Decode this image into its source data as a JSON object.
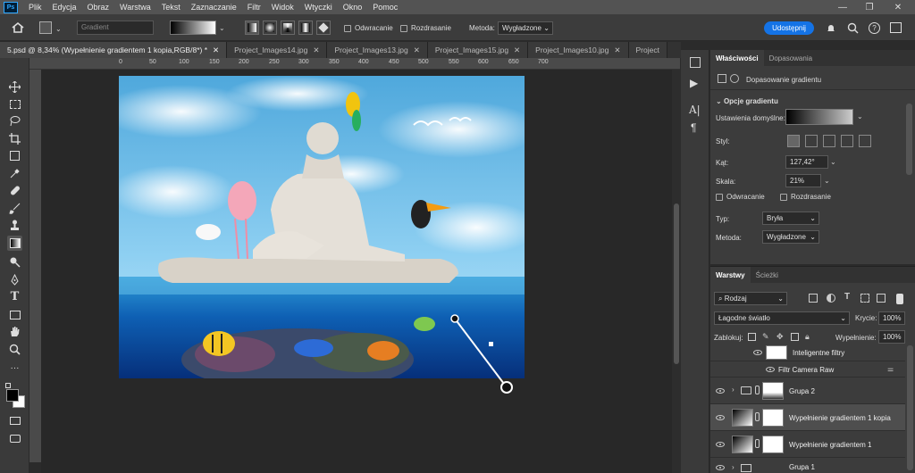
{
  "menubar": {
    "logo": "Ps",
    "items": [
      "Plik",
      "Edycja",
      "Obraz",
      "Warstwa",
      "Tekst",
      "Zaznaczanie",
      "Filtr",
      "Widok",
      "Wtyczki",
      "Okno",
      "Pomoc"
    ]
  },
  "options": {
    "preset_placeholder": "Gradient",
    "reverse_label": "Odwracanie",
    "dither_label": "Rozdrasanie",
    "method_label": "Metoda:",
    "method_value": "Wygładzone",
    "share_label": "Udostępnij"
  },
  "tabs": [
    {
      "label": "5.psd @ 8,34% (Wypełnienie gradientem 1 kopia,RGB/8*) *",
      "active": true
    },
    {
      "label": "Project_Images14.jpg",
      "active": false
    },
    {
      "label": "Project_Images13.jpg",
      "active": false
    },
    {
      "label": "Project_Images15.jpg",
      "active": false
    },
    {
      "label": "Project_Images10.jpg",
      "active": false
    },
    {
      "label": "Project",
      "active": false
    }
  ],
  "ruler": {
    "ticks": [
      "0",
      "50",
      "100",
      "150",
      "200",
      "250",
      "300",
      "350",
      "400",
      "450",
      "500",
      "550",
      "600",
      "650",
      "700"
    ]
  },
  "properties": {
    "tab_active": "Właściwości",
    "tab_other": "Dopasowania",
    "header": "Dopasowanie gradientu",
    "section": "Opcje gradientu",
    "preset_label": "Ustawienia domyślne:",
    "style_label": "Styl:",
    "angle_label": "Kąt:",
    "angle_value": "127,42°",
    "scale_label": "Skala:",
    "scale_value": "21%",
    "reverse_label": "Odwracanie",
    "dither_label": "Rozdrasanie",
    "type_label": "Typ:",
    "type_value": "Bryła",
    "method_label": "Metoda:",
    "method_value": "Wygładzone"
  },
  "layers": {
    "tab_active": "Warstwy",
    "tab_other": "Ścieżki",
    "filter_value": "Rodzaj",
    "blend_mode": "Łagodne światło",
    "opacity_label": "Krycie:",
    "opacity_value": "100%",
    "lock_label": "Zablokuj:",
    "fill_label": "Wypełnienie:",
    "fill_value": "100%",
    "rows": [
      {
        "name": "Inteligentne filtry"
      },
      {
        "name": "Filtr Camera Raw"
      },
      {
        "name": "Grupa 2"
      },
      {
        "name": "Wypełnienie gradientem 1 kopia"
      },
      {
        "name": "Wypełnienie gradientem 1"
      },
      {
        "name": "Grupa 1"
      }
    ]
  },
  "colors": {
    "accent": "#1473e6",
    "panel_bg": "#3c3c3c",
    "canvas_bg": "#282828"
  }
}
